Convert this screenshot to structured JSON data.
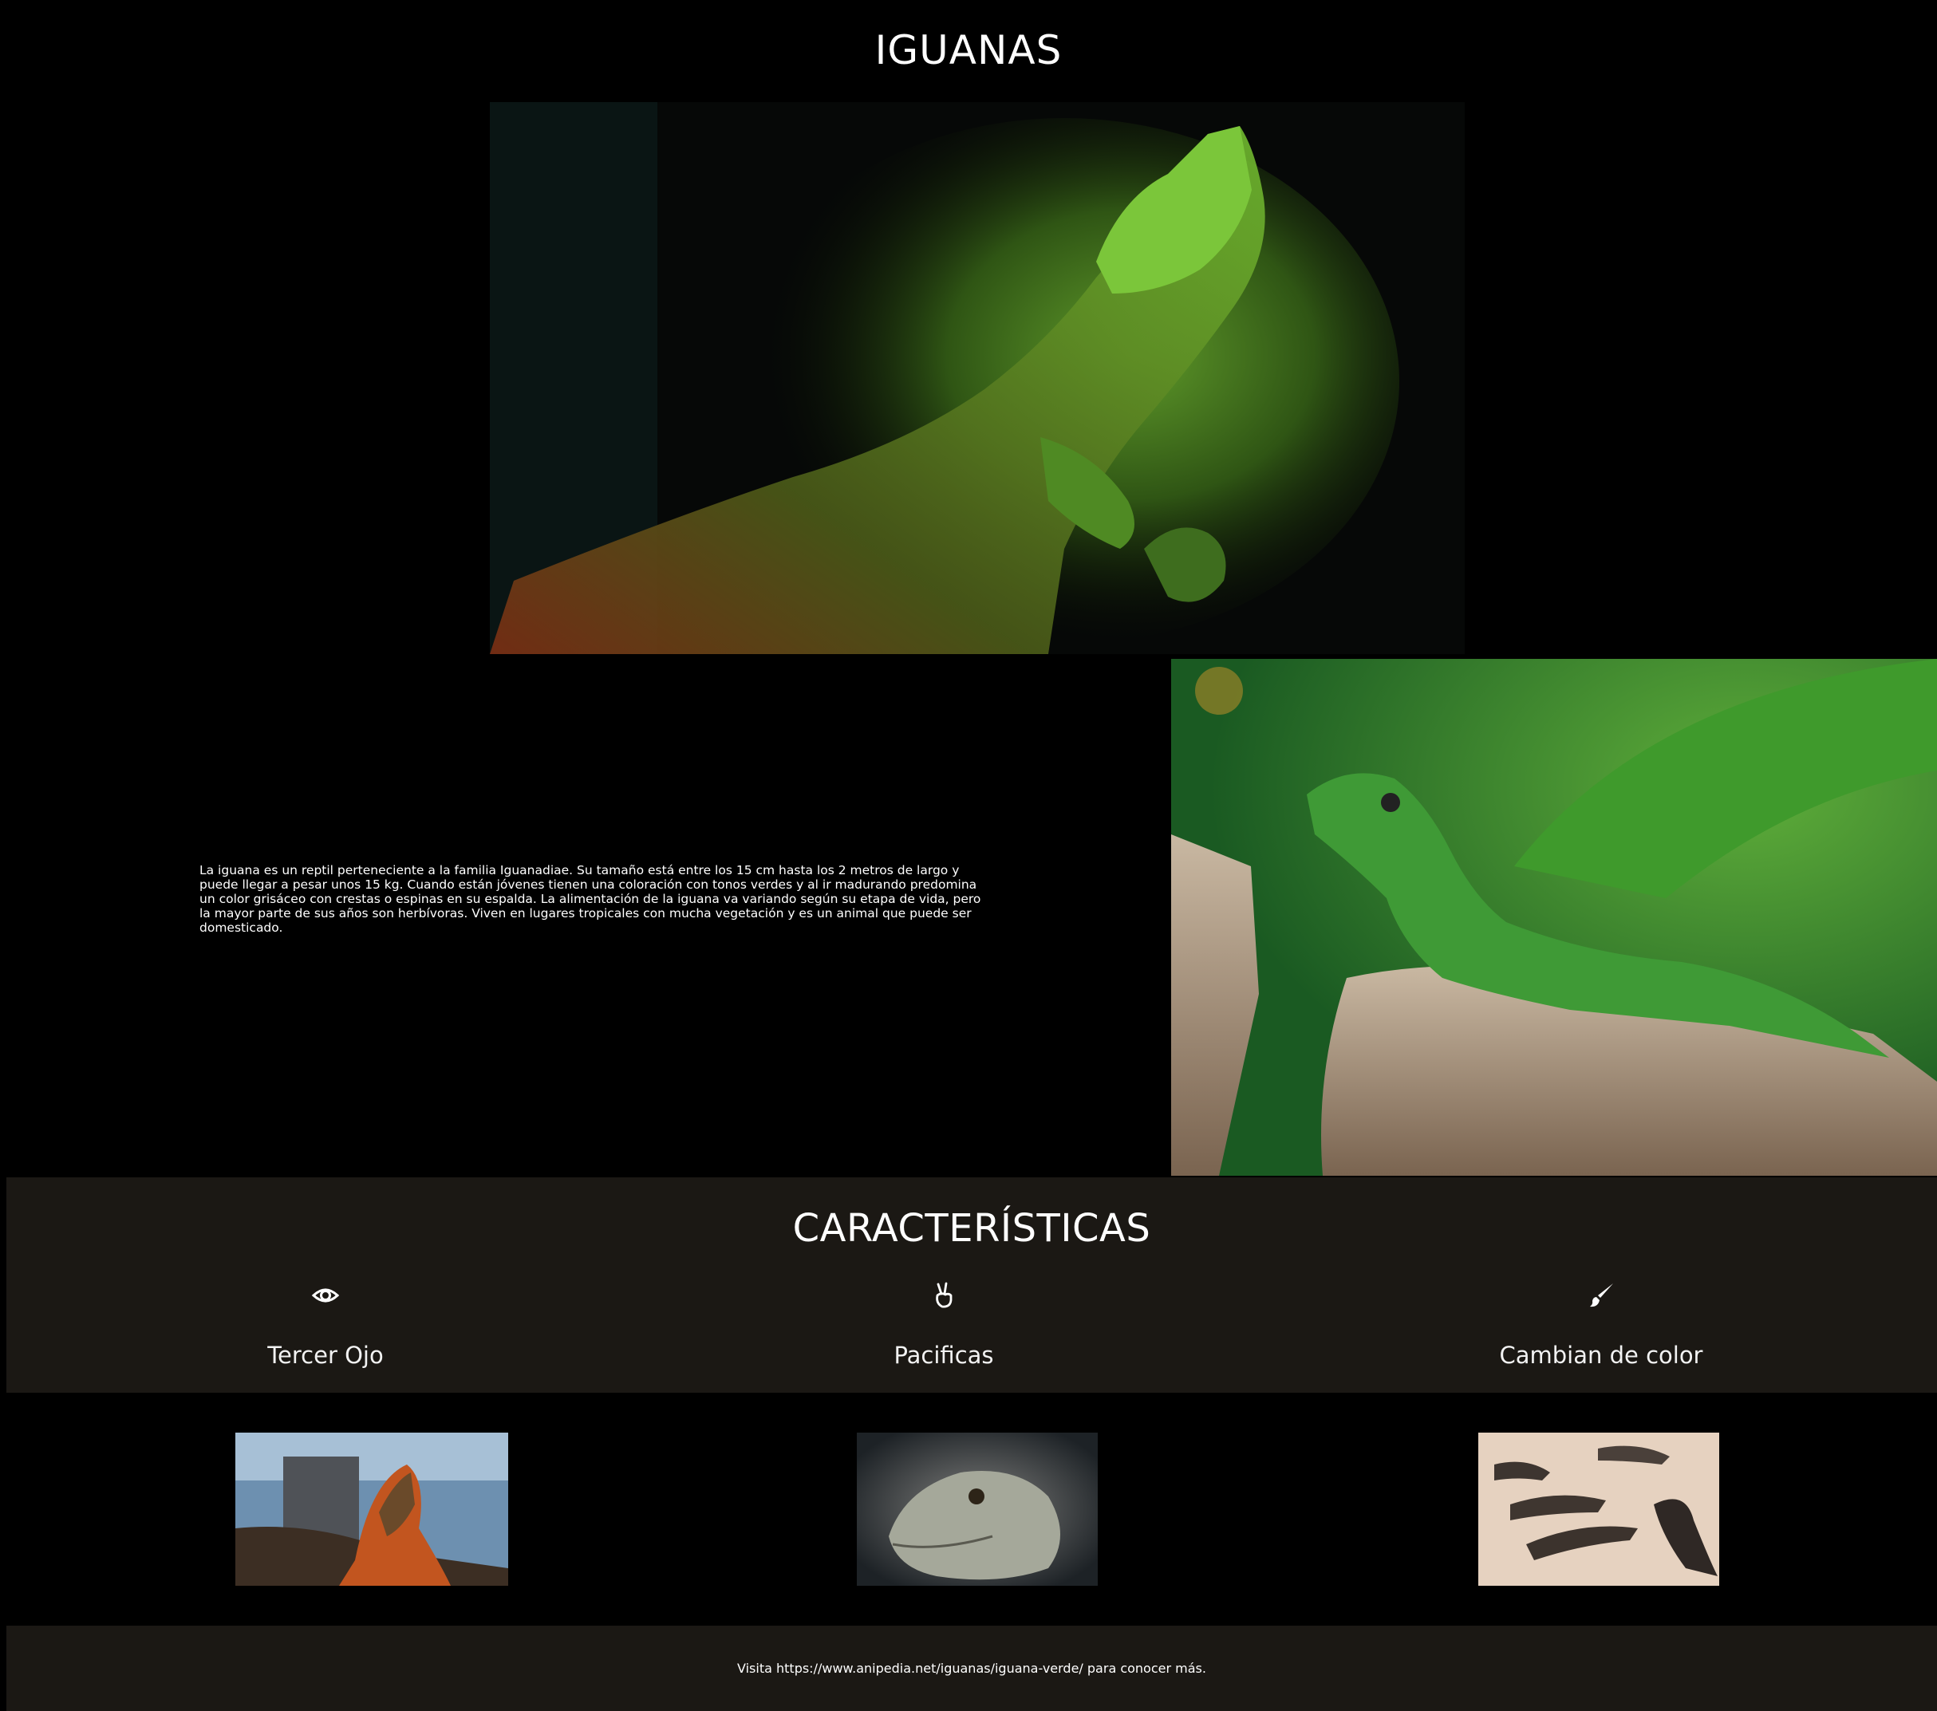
{
  "header": {
    "title": "IGUANAS"
  },
  "intro": {
    "text": "La iguana es un reptil perteneciente a la familia Iguanadiae. Su tamaño está entre los 15 cm hasta los 2 metros de largo y puede llegar a pesar unos 15 kg. Cuando están jóvenes tienen una coloración con tonos verdes y al ir madurando predomina un color grisáceo con crestas o espinas en su espalda. La alimentación de la iguana va variando según su etapa de vida, pero la mayor parte de sus años son herbívoras. Viven en lugares tropicales con mucha vegetación y es un animal que puede ser domesticado."
  },
  "features": {
    "title": "CARACTERÍSTICAS",
    "items": [
      {
        "label": "Tercer Ojo",
        "icon": "eye-icon"
      },
      {
        "label": "Pacificas",
        "icon": "peace-hand-icon"
      },
      {
        "label": "Cambian de color",
        "icon": "paintbrush-icon"
      }
    ]
  },
  "footer": {
    "text": "Visita https://www.anipedia.net/iguanas/iguana-verde/ para conocer más."
  },
  "colors": {
    "background": "#000000",
    "band": "#1b1814",
    "text": "#ffffff"
  }
}
